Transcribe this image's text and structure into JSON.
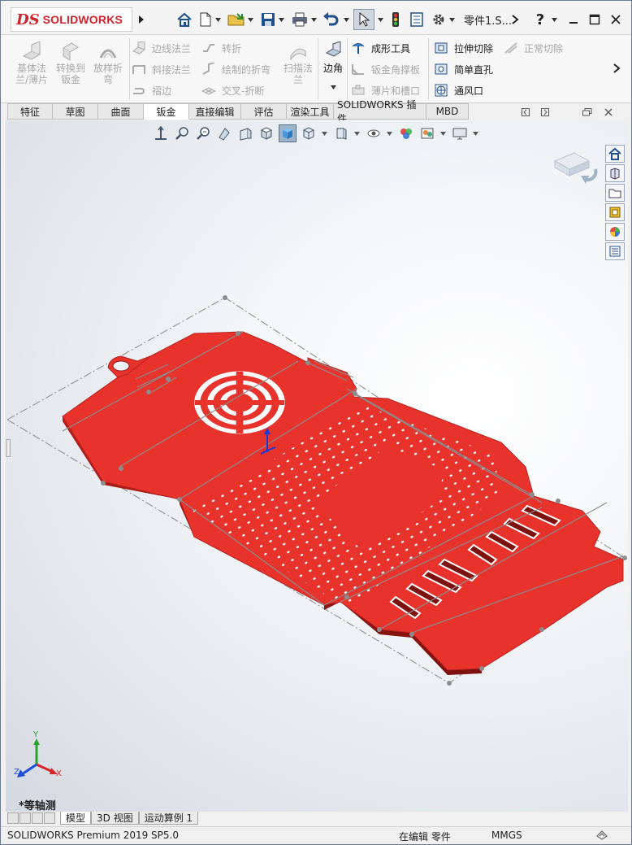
{
  "app": {
    "logo_mark": "DS",
    "logo_text": "SOLIDWORKS",
    "doc_title": "零件1.S...",
    "help": "?"
  },
  "ribbon": {
    "base_flange": "基体法兰/薄片",
    "convert": "转换到钣金",
    "loft": "放样折弯",
    "edge_flange": "边线法兰",
    "miter_flange": "斜接法兰",
    "hem": "褶边",
    "jog": "转折",
    "sketched_bend": "绘制的折弯",
    "cross_break": "交叉-折断",
    "swept_flange": "扫描法兰",
    "corner": "边角",
    "forming_tool": "成形工具",
    "gusset": "钣金角撑板",
    "tab_slot": "薄片和槽口",
    "extruded_cut": "拉伸切除",
    "simple_hole": "简单直孔",
    "vent": "通风口",
    "normal_cut": "正常切除"
  },
  "tabs": [
    "特征",
    "草图",
    "曲面",
    "钣金",
    "直接编辑",
    "评估",
    "渲染工具",
    "SOLIDWORKS 插件",
    "MBD"
  ],
  "active_tab": "钣金",
  "viewport": {
    "view_label": "*等轴测",
    "part_color": "#e8322c",
    "triad": {
      "x": "X",
      "y": "Y",
      "z": "Z"
    }
  },
  "bottom_tabs": [
    "模型",
    "3D 视图",
    "运动算例 1"
  ],
  "status": {
    "product": "SOLIDWORKS Premium 2019 SP5.0",
    "mode": "在编辑 零件",
    "units": "MMGS"
  }
}
